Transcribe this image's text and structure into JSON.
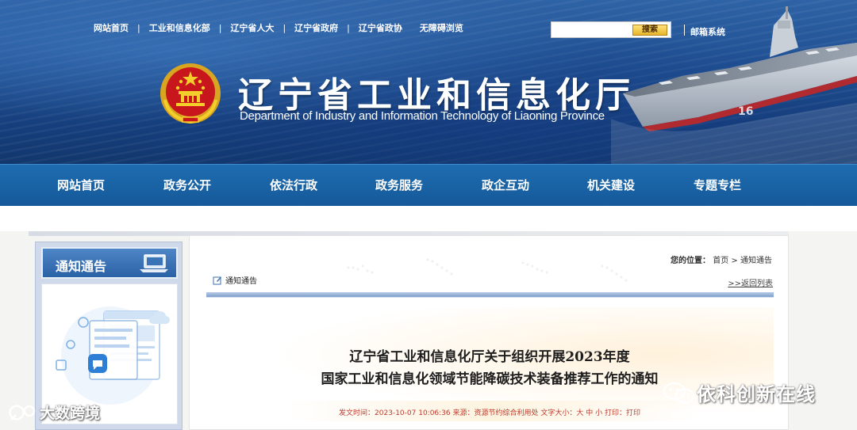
{
  "header": {
    "top_links": [
      "网站首页",
      "工业和信息化部",
      "辽宁省人大",
      "辽宁省政府",
      "辽宁省政协",
      "无障碍浏览"
    ],
    "search": {
      "placeholder": "",
      "button_label": "搜索"
    },
    "mail_link": "邮箱系统",
    "title": "辽宁省工业和信息化厅",
    "subtitle": "Department of Industry and Information Technology of Liaoning Province",
    "emblem_icon": "national-emblem-icon"
  },
  "nav": {
    "items": [
      "网站首页",
      "政务公开",
      "依法行政",
      "政务服务",
      "政企互动",
      "机关建设",
      "专题专栏"
    ]
  },
  "sidebar": {
    "title": "通知通告",
    "illustration_icon": "notice-illustration-icon"
  },
  "panel": {
    "breadcrumb_label": "您的位置：",
    "breadcrumb_home": "首页",
    "breadcrumb_sep": ">",
    "breadcrumb_current": "通知通告",
    "section_title": "通知通告",
    "back_link": ">>返回列表"
  },
  "article": {
    "title_line1": "辽宁省工业和信息化厅关于组织开展2023年度",
    "title_line2": "国家工业和信息化领域节能降碳技术装备推荐工作的通知",
    "meta": "发文时间：2023-10-07 10:06:36 来源：资源节约综合利用处 文字大小：大 中 小    打印：打印"
  },
  "watermarks": {
    "right": "依科创新在线",
    "left": "大数跨境"
  },
  "colors": {
    "nav_blue": "#1a63a6",
    "banner_blue": "#1f4f92",
    "meta_red": "#c0392b"
  }
}
